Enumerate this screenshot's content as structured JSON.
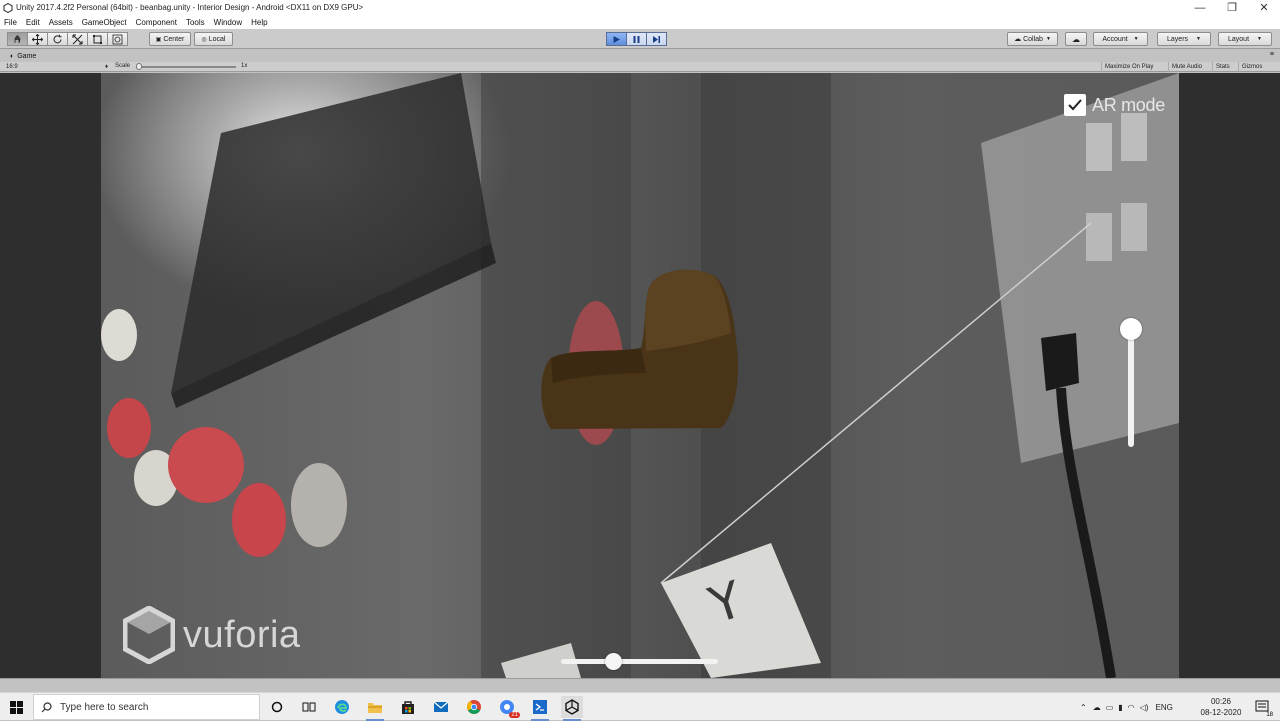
{
  "window": {
    "title": "Unity 2017.4.2f2 Personal (64bit) - beanbag.unity - Interior Design - Android <DX11 on DX9 GPU>",
    "minimize": "—",
    "maximize": "❐",
    "close": "✕"
  },
  "menu": [
    "File",
    "Edit",
    "Assets",
    "GameObject",
    "Component",
    "Tools",
    "Window",
    "Help"
  ],
  "toolbar": {
    "pivot_label": "Center",
    "space_label": "Local",
    "collab_label": "Collab",
    "account_label": "Account",
    "layers_label": "Layers",
    "layout_label": "Layout"
  },
  "game_view": {
    "tab_label": "Game",
    "aspect": "16:9",
    "scale_label": "Scale",
    "scale_value": "1x",
    "maximize_on_play": "Maximize On Play",
    "mute_audio": "Mute Audio",
    "stats": "Stats",
    "gizmos": "Gizmos"
  },
  "ar_ui": {
    "ar_mode_label": "AR mode",
    "ar_mode_checked": true,
    "vertical_slider_value": 1.0,
    "horizontal_slider_value": 0.33,
    "watermark": "vuforia",
    "banner_letter": "Y"
  },
  "taskbar": {
    "search_placeholder": "Type here to search",
    "language": "ENG",
    "time": "00:26",
    "date": "08-12-2020",
    "notification_count": "18",
    "mail_badge": "21"
  },
  "colors": {
    "play_active": "#6f9be6",
    "unity_gray": "#c2c2c2",
    "beanbag": "#4a3418"
  }
}
